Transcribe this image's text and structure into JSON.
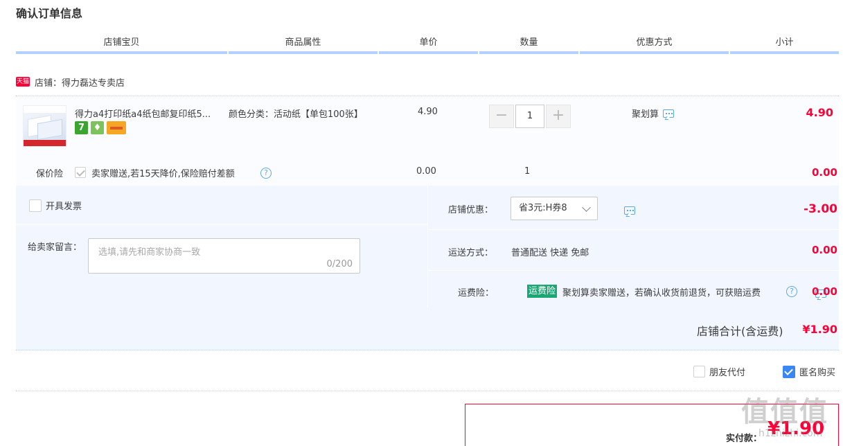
{
  "page": {
    "title": "确认订单信息"
  },
  "table_headers": [
    "店铺宝贝",
    "商品属性",
    "单价",
    "数量",
    "优惠方式",
    "小计"
  ],
  "shop": {
    "badge": "天猫",
    "label": "店铺：得力磊达专卖店"
  },
  "item": {
    "name": "得力a4打印纸a4纸包邮复印纸5...",
    "attribute": "颜色分类：活动纸【单包100张】",
    "price": "4.90",
    "quantity": "1",
    "promotion": "聚划算",
    "subtotal": "4.90",
    "badges": [
      "7",
      "shield-badge",
      "card-badge"
    ]
  },
  "insurance": {
    "label": "保价险",
    "text": "卖家赠送,若15天降价,保险赔付差额",
    "help": "?",
    "price": "0.00",
    "quantity": "1",
    "subtotal": "0.00"
  },
  "invoice": {
    "label": "开具发票"
  },
  "message": {
    "label": "给卖家留言：",
    "placeholder": "选填,请先和商家协商一致",
    "counter": "0/200"
  },
  "coupon": {
    "label": "店铺优惠：",
    "selected": "省3元:H券8",
    "amount": "-3.00"
  },
  "shipping": {
    "label": "运送方式：",
    "value": "普通配送 快递 免邮",
    "amount": "0.00"
  },
  "freight_insurance": {
    "label": "运费险：",
    "tag": "运费险",
    "text": "聚划算卖家赠送，若确认收货前退货，可获赔运费",
    "amount": "0.00"
  },
  "shop_total": {
    "label": "店铺合计(含运费)",
    "value": "¥1.90"
  },
  "options": {
    "friend_pay": "朋友代付",
    "anonymous": "匿名购买"
  },
  "payment": {
    "label": "实付款：",
    "value": "¥1.90"
  },
  "watermark": {
    "text": "值值值",
    "sub": "h1zhizhi.com"
  },
  "colors": {
    "accent_red": "#ff0036",
    "header_border": "#b2d1ff",
    "panel_bg": "#f2f7ff",
    "freight_tag": "#1aa774",
    "check_blue": "#3a86f3"
  }
}
